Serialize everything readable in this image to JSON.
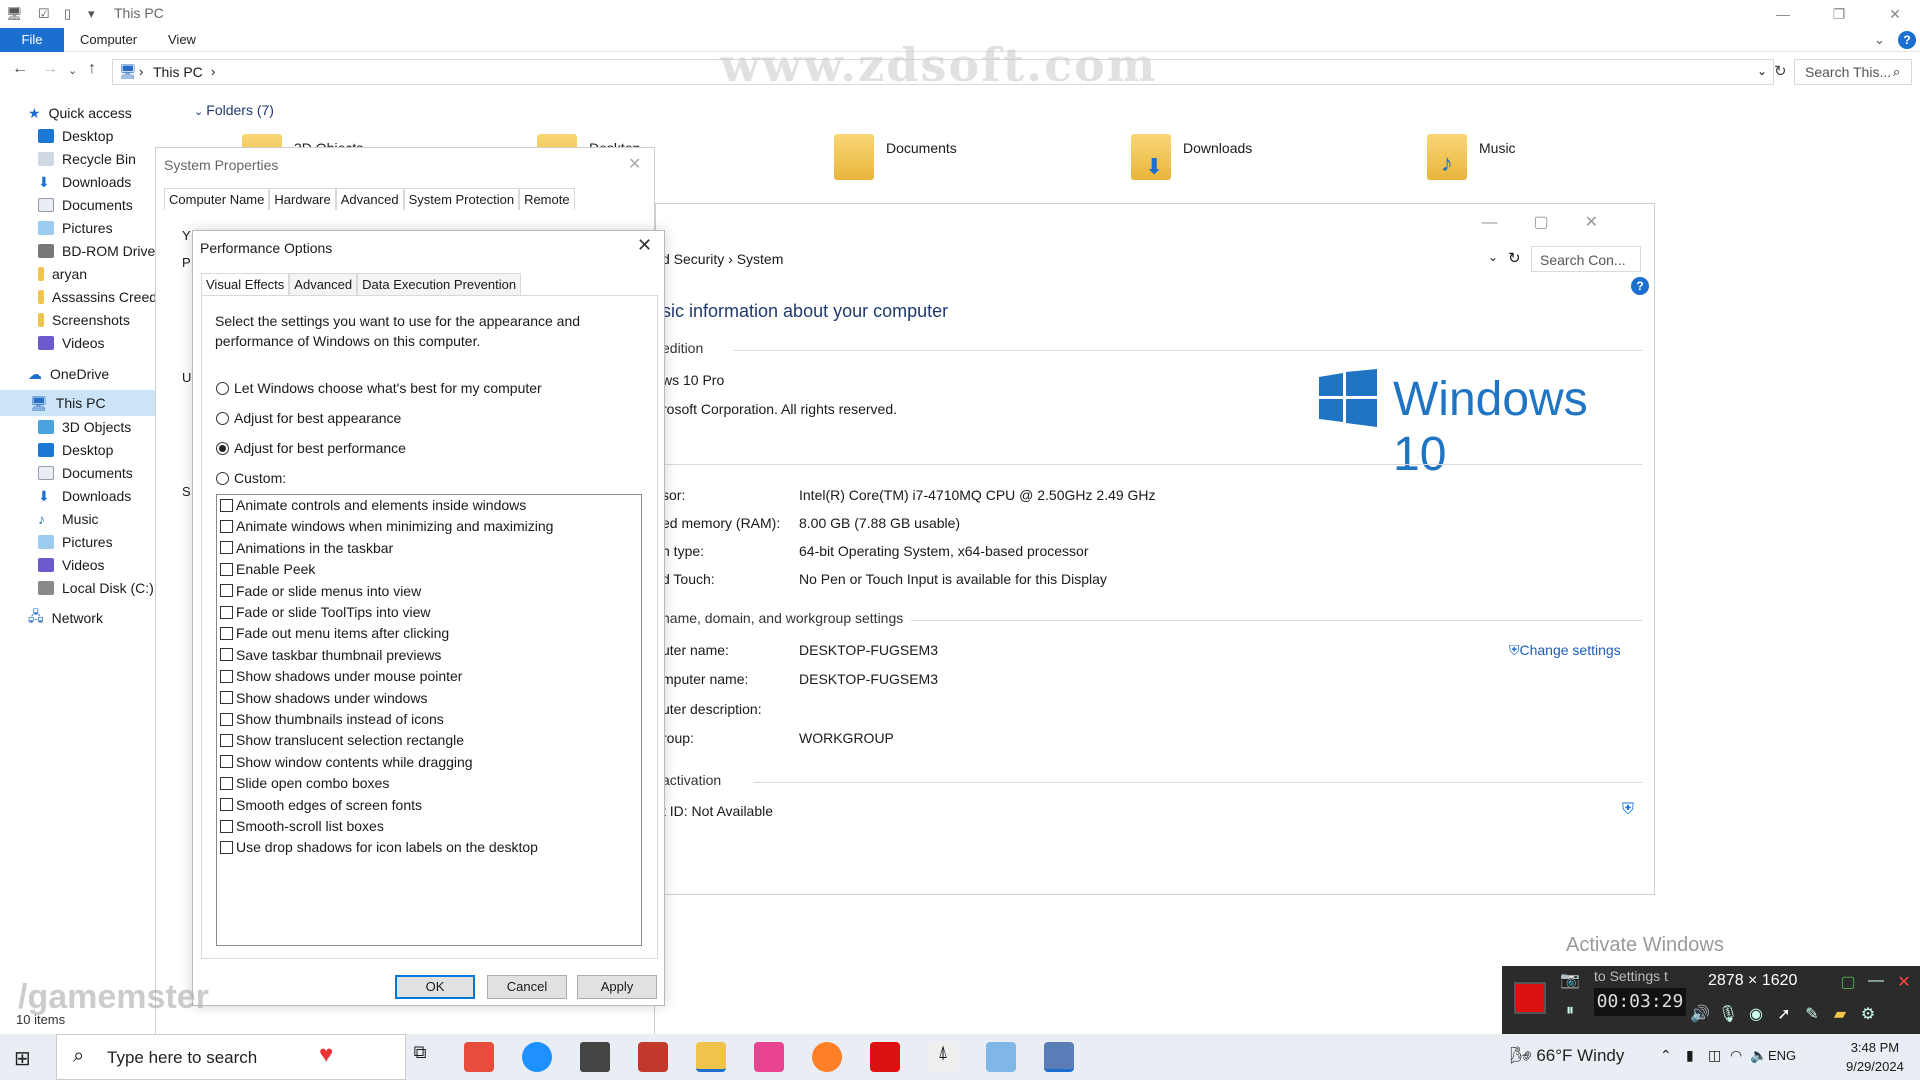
{
  "explorer": {
    "title": "This PC",
    "tabs": [
      "File",
      "Computer",
      "View"
    ],
    "address": "This PC",
    "search_placeholder": "Search This...",
    "folders_header": "Folders (7)",
    "folders": [
      "3D Objects",
      "Desktop",
      "Documents",
      "Downloads",
      "Music"
    ],
    "status": "10 items"
  },
  "sidebar": {
    "quick_access": "Quick access",
    "quick_items": [
      "Desktop",
      "Recycle Bin",
      "Downloads",
      "Documents",
      "Pictures",
      "BD-ROM Drive",
      "aryan",
      "Assassins Creed",
      "Screenshots",
      "Videos"
    ],
    "onedrive": "OneDrive",
    "this_pc": "This PC",
    "pc_items": [
      "3D Objects",
      "Desktop",
      "Documents",
      "Downloads",
      "Music",
      "Pictures",
      "Videos",
      "Local Disk (C:)"
    ],
    "network": "Network"
  },
  "system_window": {
    "breadcrumb_part": "d Security",
    "breadcrumb_current": "System",
    "search_placeholder": "Search Con...",
    "heading": "sic information about your computer",
    "edition_header": "edition",
    "edition": "ws 10 Pro",
    "copyright": "rosoft Corporation. All rights reserved.",
    "logo_text": "Windows 10",
    "rows": [
      {
        "label": "sor:",
        "value": "Intel(R) Core(TM) i7-4710MQ CPU @ 2.50GHz   2.49 GHz"
      },
      {
        "label": "ed memory (RAM):",
        "value": "8.00 GB (7.88 GB usable)"
      },
      {
        "label": "n type:",
        "value": "64-bit Operating System, x64-based processor"
      },
      {
        "label": "d Touch:",
        "value": "No Pen or Touch Input is available for this Display"
      }
    ],
    "name_header": "name, domain, and workgroup settings",
    "name_rows": [
      {
        "label": "uter name:",
        "value": "DESKTOP-FUGSEM3"
      },
      {
        "label": "mputer name:",
        "value": "DESKTOP-FUGSEM3"
      },
      {
        "label": "uter description:",
        "value": ""
      },
      {
        "label": "roup:",
        "value": "WORKGROUP"
      }
    ],
    "change_settings": "Change settings",
    "activation_header": "activation",
    "activation_row": "t ID:  Not Available"
  },
  "system_properties": {
    "title": "System Properties",
    "tabs": [
      "Computer Name",
      "Hardware",
      "Advanced",
      "System Protection",
      "Remote"
    ],
    "partial_letters": [
      "Y",
      "P",
      "U",
      "S"
    ]
  },
  "performance_options": {
    "title": "Performance Options",
    "tabs": [
      "Visual Effects",
      "Advanced",
      "Data Execution Prevention"
    ],
    "description": "Select the settings you want to use for the appearance and performance of Windows on this computer.",
    "radio_options": [
      {
        "label": "Let Windows choose what's best for my computer",
        "selected": false
      },
      {
        "label": "Adjust for best appearance",
        "selected": false
      },
      {
        "label": "Adjust for best performance",
        "selected": true
      },
      {
        "label": "Custom:",
        "selected": false
      }
    ],
    "effects": [
      "Animate controls and elements inside windows",
      "Animate windows when minimizing and maximizing",
      "Animations in the taskbar",
      "Enable Peek",
      "Fade or slide menus into view",
      "Fade or slide ToolTips into view",
      "Fade out menu items after clicking",
      "Save taskbar thumbnail previews",
      "Show shadows under mouse pointer",
      "Show shadows under windows",
      "Show thumbnails instead of icons",
      "Show translucent selection rectangle",
      "Show window contents while dragging",
      "Slide open combo boxes",
      "Smooth edges of screen fonts",
      "Smooth-scroll list boxes",
      "Use drop shadows for icon labels on the desktop"
    ],
    "ok": "OK",
    "cancel": "Cancel",
    "apply": "Apply"
  },
  "overlays": {
    "watermark_top": "www.zdsoft.com",
    "watermark_bottom": "/gamemster",
    "activate": "Activate Windows",
    "recorder_hint": "to Settings t",
    "recorder_resolution": "2878 × 1620",
    "recorder_time": "00:03:29"
  },
  "taskbar": {
    "search_placeholder": "Type here to search",
    "weather": "66°F  Windy",
    "lang": "ENG",
    "time": "3:48 PM",
    "date": "9/29/2024"
  },
  "colors": {
    "accent": "#1a6fcf",
    "folder": "#f0c44c",
    "recorder_bg": "#2b2b2b",
    "record_red": "#dd1111"
  }
}
